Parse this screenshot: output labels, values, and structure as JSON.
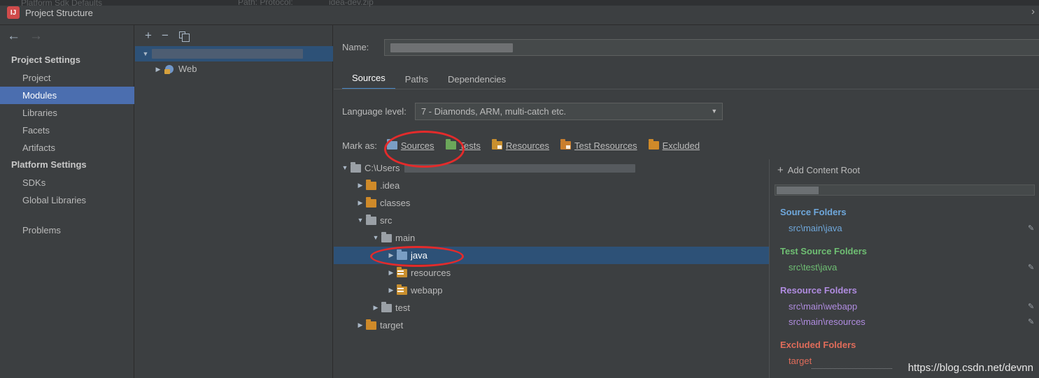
{
  "window": {
    "title": "Project Structure",
    "icon": "intellij-logo-icon",
    "close_chevron": "›",
    "ghost_top_left": "Platform Sdk Defaults",
    "ghost_top_mid": "Path: Protocol: ",
    "ghost_top_right": "idea-dev.zip"
  },
  "sidebar": {
    "back_arrow": "←",
    "forward_arrow": "→",
    "groups": [
      {
        "label": "Project Settings",
        "items": [
          {
            "label": "Project",
            "selected": false
          },
          {
            "label": "Modules",
            "selected": true
          },
          {
            "label": "Libraries",
            "selected": false
          },
          {
            "label": "Facets",
            "selected": false
          },
          {
            "label": "Artifacts",
            "selected": false
          }
        ]
      },
      {
        "label": "Platform Settings",
        "items": [
          {
            "label": "SDKs",
            "selected": false
          },
          {
            "label": "Global Libraries",
            "selected": false
          }
        ]
      }
    ],
    "problems": "Problems"
  },
  "module_tree": {
    "toolbar": {
      "add": "+",
      "remove": "−",
      "copy": "copy-icon"
    },
    "rows": [
      {
        "twisty": "▼",
        "label": "",
        "redacted": true,
        "selected": true,
        "indent": 0,
        "icon": "module-icon"
      },
      {
        "twisty": "▶",
        "label": "Web",
        "redacted": false,
        "selected": false,
        "indent": 1,
        "icon": "web-facet-icon"
      }
    ]
  },
  "module_panel": {
    "name_label": "Name:",
    "name_value": "",
    "name_redacted": true,
    "tabs": [
      {
        "label": "Sources",
        "active": true
      },
      {
        "label": "Paths",
        "active": false
      },
      {
        "label": "Dependencies",
        "active": false
      }
    ],
    "language_level": {
      "label": "Language level:",
      "value": "7 - Diamonds, ARM, multi-catch etc.",
      "arrow": "▼"
    },
    "mark_as": {
      "label": "Mark as:",
      "buttons": [
        {
          "label": "Sources",
          "underline_char": "S",
          "color": "#7a9ec4",
          "icon": "sources-folder-icon"
        },
        {
          "label": "Tests",
          "underline_char": "T",
          "color": "#6ba75a",
          "icon": "tests-folder-icon"
        },
        {
          "label": "Resources",
          "underline_char": "R",
          "color": "#c98f2e",
          "icon": "resources-folder-icon"
        },
        {
          "label": "Test Resources",
          "underline_char": "e",
          "color": "#c98f2e",
          "icon": "test-resources-folder-icon"
        },
        {
          "label": "Excluded",
          "underline_char": "E",
          "color": "#cf8a29",
          "icon": "excluded-folder-icon"
        }
      ]
    },
    "content_tree": [
      {
        "twisty": "▼",
        "indent": 0,
        "label": "C:\\Users",
        "icon": "folder-gray-icon",
        "redacted_after": true,
        "selected": false,
        "color": "#bbbbbb"
      },
      {
        "twisty": "▶",
        "indent": 1,
        "label": ".idea",
        "icon": "folder-orange-icon",
        "redacted_after": false,
        "selected": false,
        "color": "#bbbbbb"
      },
      {
        "twisty": "▶",
        "indent": 1,
        "label": "classes",
        "icon": "folder-orange-icon",
        "redacted_after": false,
        "selected": false,
        "color": "#bbbbbb"
      },
      {
        "twisty": "▼",
        "indent": 1,
        "label": "src",
        "icon": "folder-gray-icon",
        "redacted_after": false,
        "selected": false,
        "color": "#bbbbbb"
      },
      {
        "twisty": "▼",
        "indent": 2,
        "label": "main",
        "icon": "folder-gray-icon",
        "redacted_after": false,
        "selected": false,
        "color": "#bbbbbb"
      },
      {
        "twisty": "▶",
        "indent": 3,
        "label": "java",
        "icon": "folder-blue-icon",
        "redacted_after": false,
        "selected": true,
        "color": "#ffffff"
      },
      {
        "twisty": "▶",
        "indent": 3,
        "label": "resources",
        "icon": "resources-folder-icon",
        "redacted_after": false,
        "selected": false,
        "color": "#bbbbbb"
      },
      {
        "twisty": "▶",
        "indent": 3,
        "label": "webapp",
        "icon": "resources-folder-icon",
        "redacted_after": false,
        "selected": false,
        "color": "#bbbbbb"
      },
      {
        "twisty": "▶",
        "indent": 2,
        "label": "test",
        "icon": "folder-gray-icon",
        "redacted_after": false,
        "selected": false,
        "color": "#bbbbbb"
      },
      {
        "twisty": "▶",
        "indent": 1,
        "label": "target",
        "icon": "folder-orange-icon",
        "redacted_after": false,
        "selected": false,
        "color": "#bbbbbb"
      }
    ]
  },
  "content_roots": {
    "add_button": "Add Content Root",
    "add_button_underline": "C",
    "add_icon": "plus-icon",
    "sections": [
      {
        "title": "Source Folders",
        "color": "#6fa8dc",
        "paths": [
          "src\\main\\java"
        ]
      },
      {
        "title": "Test Source Folders",
        "color": "#6fbf73",
        "paths": [
          "src\\test\\java"
        ]
      },
      {
        "title": "Resource Folders",
        "color": "#b08ce0",
        "paths": [
          "src\\main\\webapp",
          "src\\main\\resources"
        ]
      },
      {
        "title": "Excluded Folders",
        "color": "#e06c5a",
        "paths": [
          "target"
        ]
      }
    ],
    "edit_icon": "pencil-icon"
  },
  "annotations": {
    "watermark": "https://blog.csdn.net/devnn",
    "highlight_color": "#e32b2b",
    "ellipses": [
      "sources-mark-button-highlight",
      "java-folder-highlight"
    ]
  }
}
